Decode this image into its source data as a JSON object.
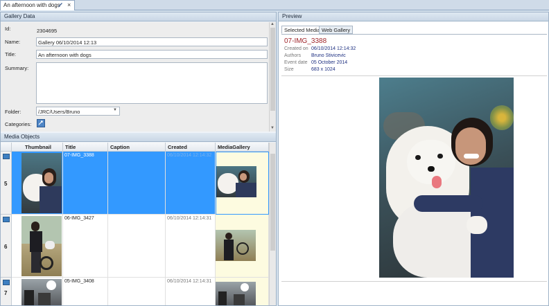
{
  "document_tab": {
    "title": "An afternoon with dogs"
  },
  "gallery_data": {
    "header": "Gallery Data",
    "id_label": "Id:",
    "id_value": "2304695",
    "name_label": "Name:",
    "name_value": "Gallery 06/10/2014 12:13",
    "title_label": "Title:",
    "title_value": "An afternoon with dogs",
    "summary_label": "Summary:",
    "summary_value": "",
    "folder_label": "Folder:",
    "folder_value": "/JRC/Users/Bruno",
    "categories_label": "Categories:"
  },
  "media_objects": {
    "header": "Media Objects",
    "columns": [
      "Thumbnail",
      "Title",
      "Caption",
      "Created",
      "MediaGallery"
    ],
    "rows": [
      {
        "num": "5",
        "title": "07-IMG_3388",
        "caption": "",
        "created": "06/10/2014 12:14:32",
        "selected": true
      },
      {
        "num": "6",
        "title": "06-IMG_3427",
        "caption": "",
        "created": "06/10/2014 12:14:31",
        "selected": false
      },
      {
        "num": "7",
        "title": "05-IMG_3408",
        "caption": "",
        "created": "06/10/2014 12:14:31",
        "selected": false
      }
    ]
  },
  "preview": {
    "header": "Preview",
    "tabs": [
      "Selected Media",
      "Web Gallery"
    ],
    "media_title": "07-IMG_3388",
    "meta": [
      {
        "label": "Created on",
        "value": "06/10/2014 12:14:32"
      },
      {
        "label": "Authors",
        "value": "Bruno Stivicevic"
      },
      {
        "label": "Event date",
        "value": "05 October 2014"
      },
      {
        "label": "Size",
        "value": "683 x 1024"
      }
    ]
  },
  "colors": {
    "selection": "#3399ff",
    "media_title": "#a0262b",
    "meta_value": "#1d2f80",
    "gallery_cell_bg": "#fdfbe0"
  }
}
